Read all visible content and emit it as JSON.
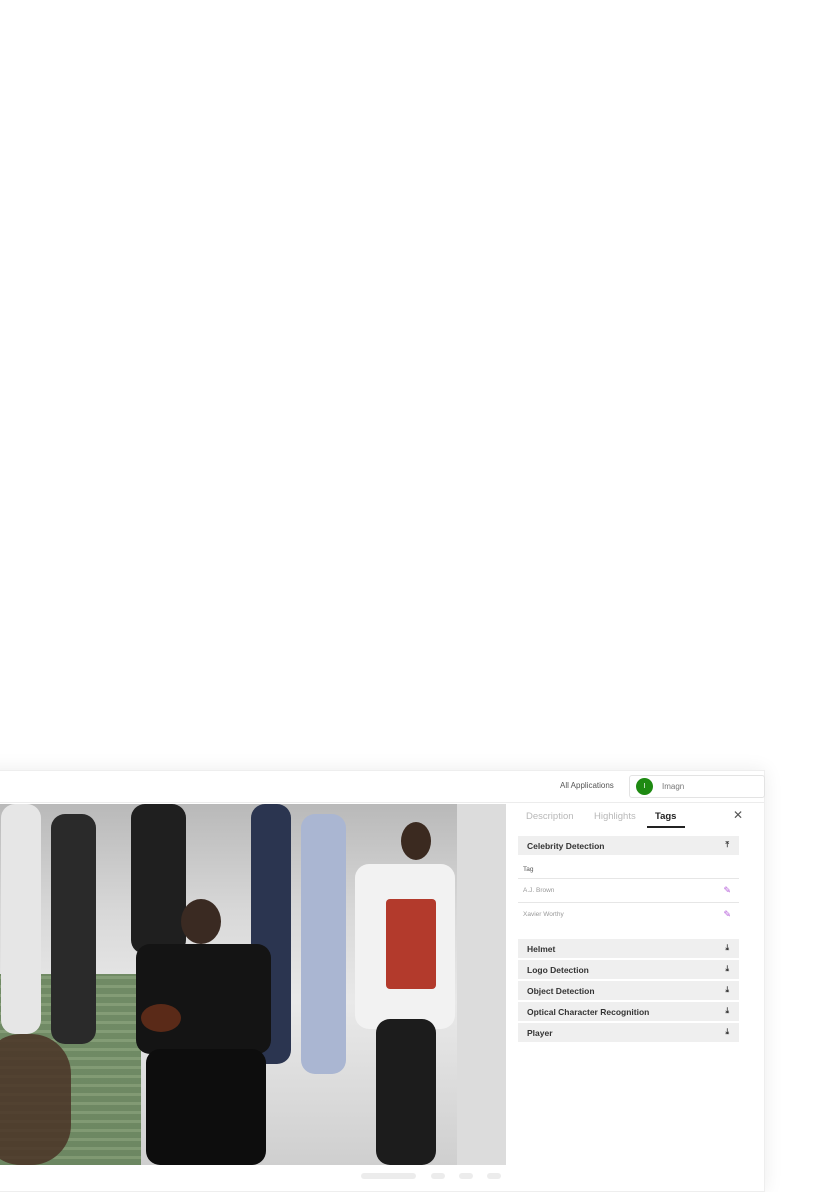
{
  "header": {
    "all_applications": "All Applications",
    "account": {
      "initial": "I",
      "name": "Imagn",
      "avatar_color": "#1e8a12"
    }
  },
  "panel": {
    "tabs": [
      {
        "label": "Description",
        "active": false
      },
      {
        "label": "Highlights",
        "active": false
      },
      {
        "label": "Tags",
        "active": true
      }
    ],
    "close_icon": "close-icon",
    "sections": [
      {
        "title": "Celebrity Detection",
        "expanded": true,
        "column_header": "Tag",
        "tags": [
          "A.J. Brown",
          "Xavier Worthy"
        ]
      },
      {
        "title": "Helmet",
        "expanded": false
      },
      {
        "title": "Logo Detection",
        "expanded": false
      },
      {
        "title": "Object Detection",
        "expanded": false
      },
      {
        "title": "Optical Character Recognition",
        "expanded": false
      },
      {
        "title": "Player",
        "expanded": false
      }
    ]
  },
  "colors": {
    "edit_icon": "#b45cd9",
    "section_bg": "#efefef",
    "active_tab": "#222222"
  }
}
